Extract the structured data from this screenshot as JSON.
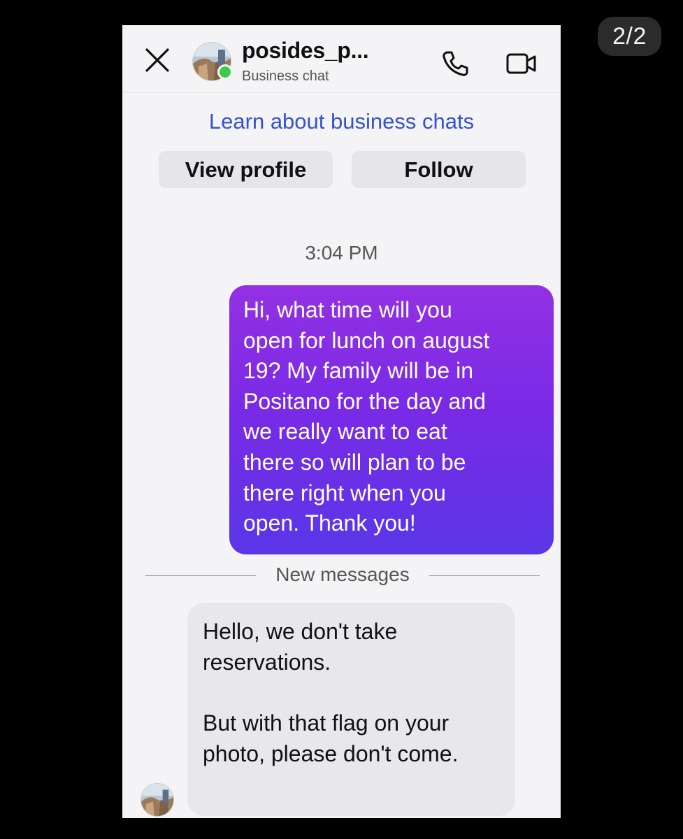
{
  "page_counter": "2/2",
  "header": {
    "chat_name": "posides_p...",
    "subtitle": "Business chat",
    "icons": {
      "close": "close-icon",
      "phone": "phone-icon",
      "video": "video-camera-icon"
    },
    "online_status_color": "#3ccb4a"
  },
  "business_info": {
    "learn_link": "Learn about business chats",
    "view_profile_label": "View profile",
    "follow_label": "Follow"
  },
  "messages": {
    "timestamp": "3:04 PM",
    "outgoing": {
      "text": "Hi, what time will you\nopen for lunch on august\n19? My family will be in\nPositano for the day and\nwe really want to eat\nthere so will plan to be\nthere right when you\nopen. Thank you!",
      "gradient_top": "#9331e4",
      "gradient_bottom": "#5a36e7"
    },
    "divider_label": "New messages",
    "incoming": {
      "paragraph_1": "Hello, we don't take reservations.",
      "paragraph_2": "But with that flag on your photo, please don't come."
    }
  },
  "colors": {
    "link": "#3652c9",
    "chat_background": "#f4f4f6",
    "incoming_bubble": "#e7e7ec"
  }
}
